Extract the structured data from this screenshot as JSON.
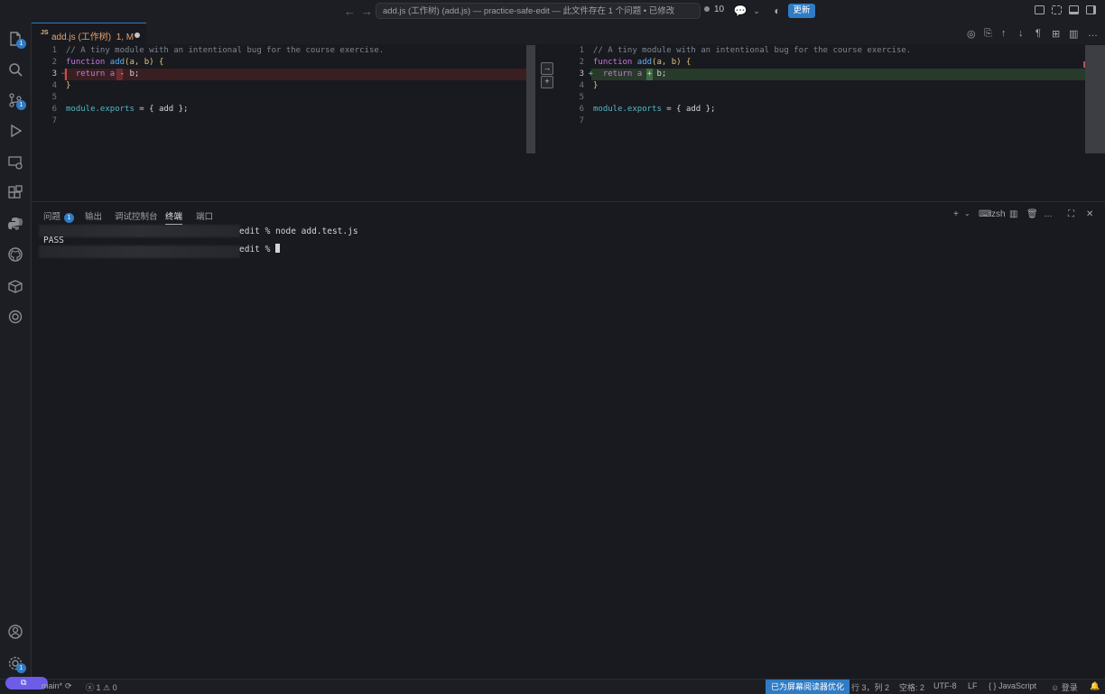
{
  "titlebar": {
    "command_center": "add.js (工作树) (add.js) — practice-safe-edit — 此文件存在 1 个问题 • 已修改",
    "notification_count": "10",
    "update_label": "更新"
  },
  "activity": {
    "explorer_badge": "1",
    "scm_badge": "1",
    "settings_badge": "1"
  },
  "tab": {
    "label": "add.js (工作树)",
    "status": "1, M"
  },
  "diff": {
    "left": {
      "line_numbers": [
        "1",
        "2",
        "3",
        "4",
        "5",
        "6",
        "7"
      ],
      "line1": "// A tiny module with an intentional bug for the course exercise.",
      "line2_kw": "function",
      "line2_fn": "add",
      "line2_args": "(a, b) ",
      "line2_br": "{",
      "line3_pre": "  return a ",
      "line3_op": "-",
      "line3_post": " b;",
      "line4": "}",
      "line6_obj": "module",
      "line6_prop": ".exports",
      "line6_rest": " = { add };"
    },
    "right": {
      "line_numbers": [
        "1",
        "2",
        "3",
        "4",
        "5",
        "6",
        "7"
      ],
      "line1": "// A tiny module with an intentional bug for the course exercise.",
      "line2_kw": "function",
      "line2_fn": "add",
      "line2_args": "(a, b) ",
      "line2_br": "{",
      "line3_pre": "  return a ",
      "line3_op": "+",
      "line3_post": " b;",
      "line4": "}",
      "line6_obj": "module",
      "line6_prop": ".exports",
      "line6_rest": " = { add };"
    }
  },
  "panel": {
    "tabs": [
      "问题",
      "输出",
      "调试控制台",
      "终端",
      "端口"
    ],
    "problems_badge": "1",
    "shell_label": "zsh",
    "terminal": {
      "line1": "edit % node add.test.js",
      "line2": "PASS",
      "line3": "edit % "
    }
  },
  "statusbar": {
    "branch": "main*",
    "errors": "1",
    "warnings": "0",
    "screen_reader": "已为屏幕阅读器优化",
    "position": "行 3，列 2",
    "spaces": "空格: 2",
    "encoding": "UTF-8",
    "eol": "LF",
    "language": "JavaScript",
    "account": "登录"
  },
  "colors": {
    "accent": "#2f7bc5",
    "removed_line": "#3a1f22",
    "added_line": "#283a2a",
    "remote_indicator": "#6c5ce7"
  }
}
